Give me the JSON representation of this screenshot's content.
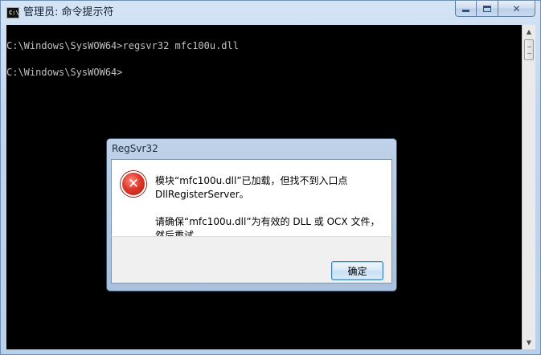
{
  "window": {
    "title": "管理员: 命令提示符",
    "icon_text": "C:\\",
    "icon_name": "cmd-icon",
    "caption_buttons": {
      "minimize": "minimize-icon",
      "maximize": "maximize-icon",
      "close": "close-icon"
    }
  },
  "console": {
    "lines": [
      "C:\\Windows\\SysWOW64>regsvr32 mfc100u.dll",
      "",
      "C:\\Windows\\SysWOW64>"
    ]
  },
  "dialog": {
    "title": "RegSvr32",
    "icon_name": "error-icon",
    "message_line1": "模块“mfc100u.dll”已加载，但找不到入口点",
    "message_line2": "DllRegisterServer。",
    "message_line3": "请确保“mfc100u.dll”为有效的 DLL 或 OCX 文件，",
    "message_line4": "然后重试。",
    "ok_label": "确定"
  },
  "colors": {
    "console_bg": "#000000",
    "console_text": "#c0c0c0",
    "error_red": "#e0392b"
  }
}
